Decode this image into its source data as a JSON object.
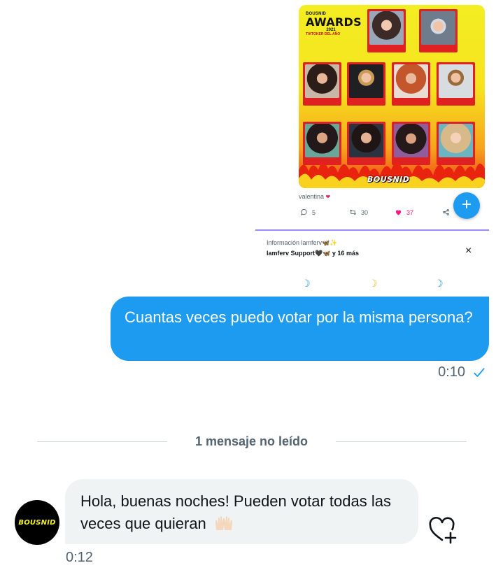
{
  "shared_tweet": {
    "poster": {
      "brand_small": "BOUSNID",
      "title": "AWARDS",
      "year": "2021",
      "category": "TIKTOKER DEL AÑO",
      "brand": "BOUSNID",
      "nominees": [
        "",
        "",
        "",
        "",
        "",
        "",
        "",
        "",
        "",
        ""
      ]
    },
    "author": "valentina",
    "replies": "5",
    "retweets": "30",
    "likes": "37",
    "fab_label": "+",
    "info_title": "Información lamferv🦋✨",
    "info_sub": "lamferv Support🖤🦋 y 16 más",
    "close_glyph": "×",
    "moons": [
      "☽",
      "☽",
      "☽"
    ]
  },
  "sent_message": {
    "text": "Cuantas veces puedo votar por la misma persona?",
    "time": "0:10"
  },
  "divider": {
    "label": "1 mensaje no leído"
  },
  "received_message": {
    "sender_avatar_text": "BOUSNID",
    "text": "Hola, buenas noches! Pueden votar todas las veces que quieran",
    "time": "0:12"
  },
  "colors": {
    "accent": "#1d9bf0",
    "incoming_bubble": "#eff3f4",
    "muted_text": "#536471",
    "like": "#f91880"
  },
  "icons": {
    "reply": "reply-icon",
    "retweet": "retweet-icon",
    "like": "heart-icon",
    "share": "share-icon",
    "read_receipt": "check-icon",
    "react": "heart-plus-icon"
  }
}
